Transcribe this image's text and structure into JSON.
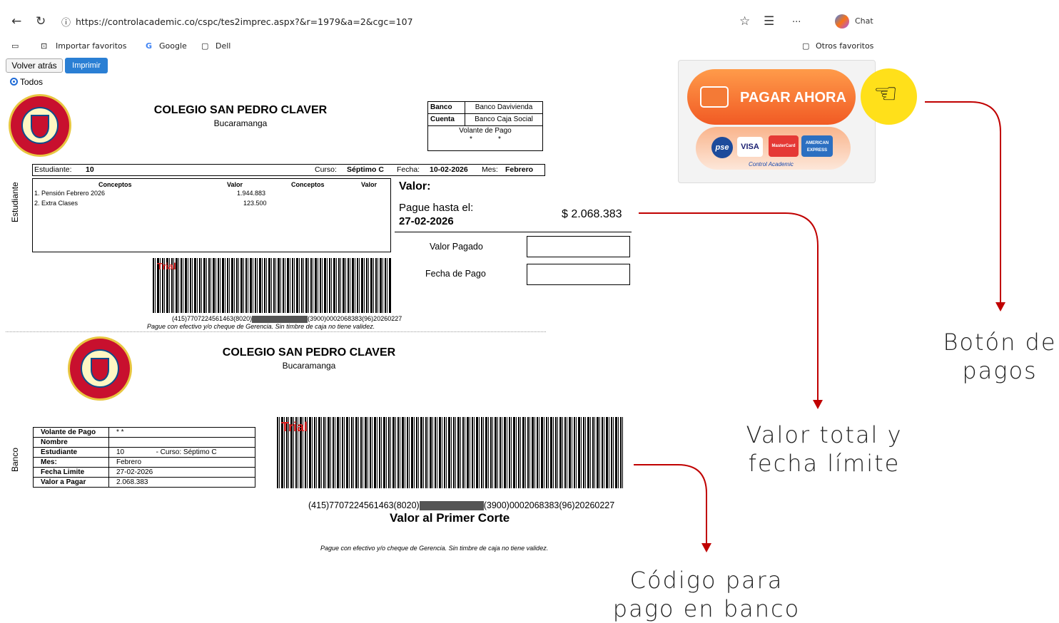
{
  "browser": {
    "url": "https://controlacademic.co/cspc/tes2imprec.aspx?&r=1979&a=2&cgc=107",
    "chat_label": "Chat",
    "more_label": "...",
    "favorites": [
      "Importar favoritos",
      "Google",
      "Dell"
    ],
    "other_favorites": "Otros favoritos"
  },
  "toolbar": {
    "back_label": "Volver atrás",
    "print_label": "Imprimir",
    "todos_label": "Todos"
  },
  "school": {
    "name": "COLEGIO SAN PEDRO CLAVER",
    "city": "Bucaramanga"
  },
  "bank_table": {
    "banco_key": "Banco",
    "banco_val": "Banco Davivienda",
    "cuenta_key": "Cuenta",
    "cuenta_val": "Banco Caja Social",
    "volante": "Volante de Pago",
    "dots": "*"
  },
  "student": {
    "label": "Estudiante:",
    "id": "10",
    "curso_label": "Curso:",
    "curso": "Séptimo C",
    "fecha_label": "Fecha:",
    "fecha": "10-02-2026",
    "mes_label": "Mes:",
    "mes": "Febrero"
  },
  "concepts": {
    "hdr_conceptos": "Conceptos",
    "hdr_valor": "Valor",
    "items": [
      {
        "name": "1. Pensión Febrero 2026",
        "value": "1.944.883"
      },
      {
        "name": "2. Extra Clases",
        "value": "123.500"
      }
    ]
  },
  "side_labels": {
    "estudiante": "Estudiante",
    "banco": "Banco"
  },
  "valor": {
    "title": "Valor:",
    "pague_hasta": "Pague hasta el:",
    "fecha_limite": "27-02-2026",
    "amount": "$ 2.068.383",
    "valor_pagado": "Valor Pagado",
    "fecha_pago": "Fecha de Pago"
  },
  "barcode": {
    "red_label": "Trial",
    "code_prefix": "(415)7707224561463(8020)",
    "code_suffix": "(3900)0002068383(96)20260227",
    "note": "Pague con efectivo y/o cheque de Gerencia. Sin timbre de caja no tiene validez."
  },
  "bank_info": {
    "rows": [
      {
        "k": "Volante de Pago",
        "v": "*          *"
      },
      {
        "k": "Nombre",
        "v": ""
      },
      {
        "k": "Estudiante",
        "v": "10                - Curso: Séptimo C"
      },
      {
        "k": "Mes:",
        "v": "Febrero"
      },
      {
        "k": "Fecha Limite",
        "v": "27-02-2026"
      },
      {
        "k": "Valor a Pagar",
        "v": "2.068.383"
      }
    ]
  },
  "valor_primer_corte": "Valor al Primer Corte",
  "payment": {
    "button_label": "PAGAR AHORA",
    "cards": [
      "pse",
      "VISA",
      "MasterCard",
      "AMERICAN EXPRESS"
    ],
    "tagline": "Control Academic"
  },
  "annotations": {
    "botones": "Botón de\npagos",
    "valor": "Valor total y\nfecha límite",
    "codigo": "Código para\npago en banco"
  },
  "colors": {
    "accent_red": "#c00000",
    "pay_orange": "#f15a24",
    "hand_yellow": "#ffe01a",
    "print_blue": "#2a7fd4"
  }
}
